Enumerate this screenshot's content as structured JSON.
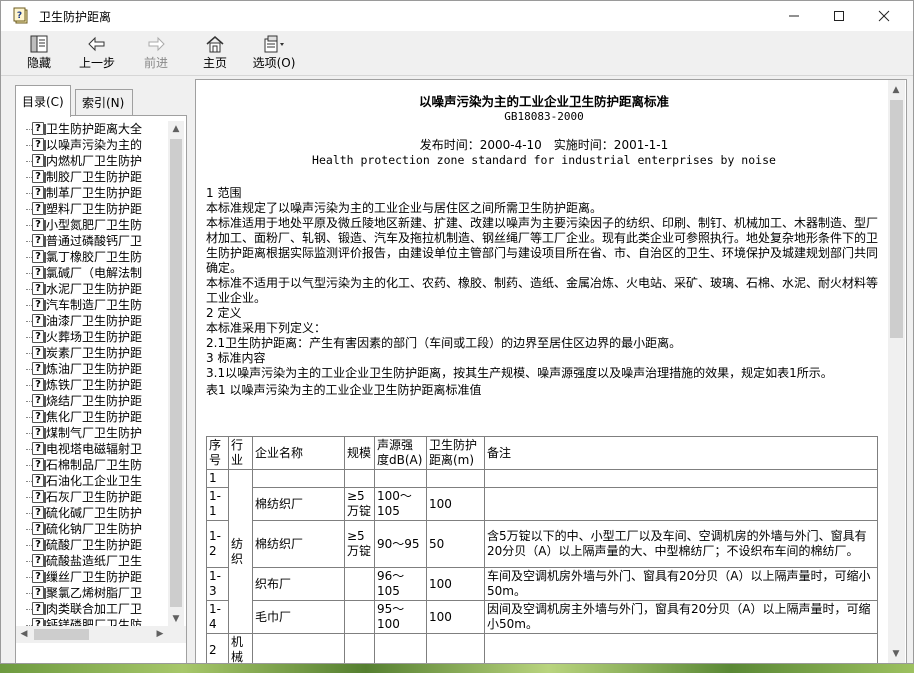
{
  "window": {
    "title": "卫生防护距离"
  },
  "toolbar": {
    "hide_label": "隐藏",
    "back_label": "上一步",
    "forward_label": "前进",
    "home_label": "主页",
    "options_label": "选项(O)"
  },
  "tabs": {
    "toc_label": "目录(C)",
    "index_label": "索引(N)"
  },
  "tree": {
    "items": [
      "卫生防护距离大全",
      "以噪声污染为主的",
      "内燃机厂卫生防护",
      "制胶厂卫生防护距",
      "制革厂卫生防护距",
      "塑料厂卫生防护距",
      "小型氮肥厂卫生防",
      "普通过磷酸钙厂卫",
      "氯丁橡胶厂卫生防",
      "氯碱厂（电解法制",
      "水泥厂卫生防护距",
      "汽车制造厂卫生防",
      "油漆厂卫生防护距",
      "火葬场卫生防护距",
      "炭素厂卫生防护距",
      "炼油厂卫生防护距",
      "炼铁厂卫生防护距",
      "烧结厂卫生防护距",
      "焦化厂卫生防护距",
      "煤制气厂卫生防护",
      "电视塔电磁辐射卫",
      "石棉制品厂卫生防",
      "石油化工企业卫生",
      "石灰厂卫生防护距",
      "硫化碱厂卫生防护",
      "硫化钠厂卫生防护",
      "硫酸厂卫生防护距",
      "硫酸盐造纸厂卫生",
      "缫丝厂卫生防护距",
      "聚氯乙烯树脂厂卫",
      "肉类联合加工厂卫",
      "钙镁磷肥厂卫生防",
      "铅蓄电池厂卫生防"
    ]
  },
  "doc": {
    "title": "以噪声污染为主的工业企业卫生防护距离标准",
    "code": "GB18083-2000",
    "dates": "发布时间：2000-4-10　实施时间：2001-1-1",
    "english_title": "Health protection zone standard for industrial enterprises by noise",
    "paragraphs": [
      "1 范围",
      "本标准规定了以噪声污染为主的工业企业与居住区之间所需卫生防护距离。",
      "本标准适用于地处平原及微丘陵地区新建、扩建、改建以噪声为主要污染因子的纺织、印刷、制钉、机械加工、木器制造、型厂材加工、面粉厂、轧钢、锻造、汽车及拖拉机制造、钢丝绳厂等工厂企业。现有此类企业可参照执行。地处复杂地形条件下的卫生防护距离根据实际监测评价报告，由建设单位主管部门与建设项目所在省、市、自治区的卫生、环境保护及城建规划部门共同确定。",
      "本标准不适用于以气型污染为主的化工、农药、橡胶、制药、造纸、金属冶炼、火电站、采矿、玻璃、石棉、水泥、耐火材料等工业企业。",
      "2 定义",
      "本标准采用下列定义：",
      "2.1卫生防护距离：产生有害因素的部门（车间或工段）的边界至居住区边界的最小距离。",
      "3 标准内容",
      "3.1以噪声污染为主的工业企业卫生防护距离，按其生产规模、噪声源强度以及噪声治理措施的效果，规定如表1所示。",
      "表1 以噪声污染为主的工业企业卫生防护距离标准值"
    ],
    "table": {
      "headers": [
        "序号",
        "行业",
        "企业名称",
        "规模",
        "声源强度dB(A)",
        "卫生防护距离(m)",
        "备注"
      ],
      "rows": [
        {
          "no": "1",
          "industry": "",
          "name": "",
          "scale": "",
          "db": "",
          "dist": "",
          "note": ""
        },
        {
          "no": "1-1",
          "name": "棉纺织厂",
          "scale": "≥5万锭",
          "db": "100～105",
          "dist": "100",
          "note": ""
        },
        {
          "no": "1-2",
          "name": "棉纺织厂",
          "scale": "≥5万锭",
          "db": "90～95",
          "dist": "50",
          "note": "含5万锭以下的中、小型工厂以及车间、空调机房的外墙与外门、窗具有20分贝（A）以上隔声量的大、中型棉纺厂；不设织布车间的棉纺厂。"
        },
        {
          "no": "1-3",
          "name": "织布厂",
          "scale": "",
          "db": "96～105",
          "dist": "100",
          "note": "车间及空调机房外墙与外门、窗具有20分贝（A）以上隔声量时，可缩小50m。"
        },
        {
          "no": "1-4",
          "name": "毛巾厂",
          "scale": "",
          "db": "95～100",
          "dist": "100",
          "note": "因间及空调机房主外墙与外门，窗具有20分贝（A）以上隔声量时，可缩小50m。"
        },
        {
          "no": "2",
          "industry": "机械",
          "name": "",
          "scale": "",
          "db": "",
          "dist": "",
          "note": ""
        }
      ],
      "textile_industry": "纺织"
    }
  }
}
